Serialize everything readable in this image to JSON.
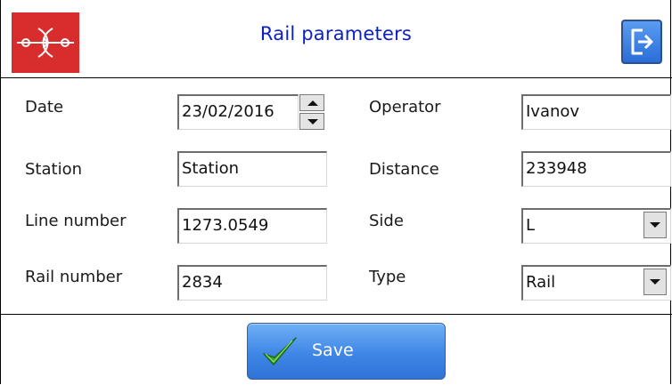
{
  "header": {
    "title": "Rail parameters",
    "logo_icon": "rail-crossing-logo-icon",
    "exit_icon": "exit-icon"
  },
  "form": {
    "date": {
      "label": "Date",
      "value": "23/02/2016"
    },
    "operator": {
      "label": "Operator",
      "value": "Ivanov"
    },
    "station": {
      "label": "Station",
      "value": "Station"
    },
    "distance": {
      "label": "Distance",
      "value": "233948"
    },
    "line_number": {
      "label": "Line number",
      "value": "1273.0549"
    },
    "side": {
      "label": "Side",
      "value": "L"
    },
    "rail_number": {
      "label": "Rail number",
      "value": "2834"
    },
    "type": {
      "label": "Type",
      "value": "Rail"
    }
  },
  "footer": {
    "save_label": "Save",
    "save_icon": "checkmark-icon"
  },
  "colors": {
    "title": "#0b1fc6",
    "logo_bg": "#d82d2d",
    "button_blue": "#3f86e6",
    "check_green": "#3aa52a"
  }
}
